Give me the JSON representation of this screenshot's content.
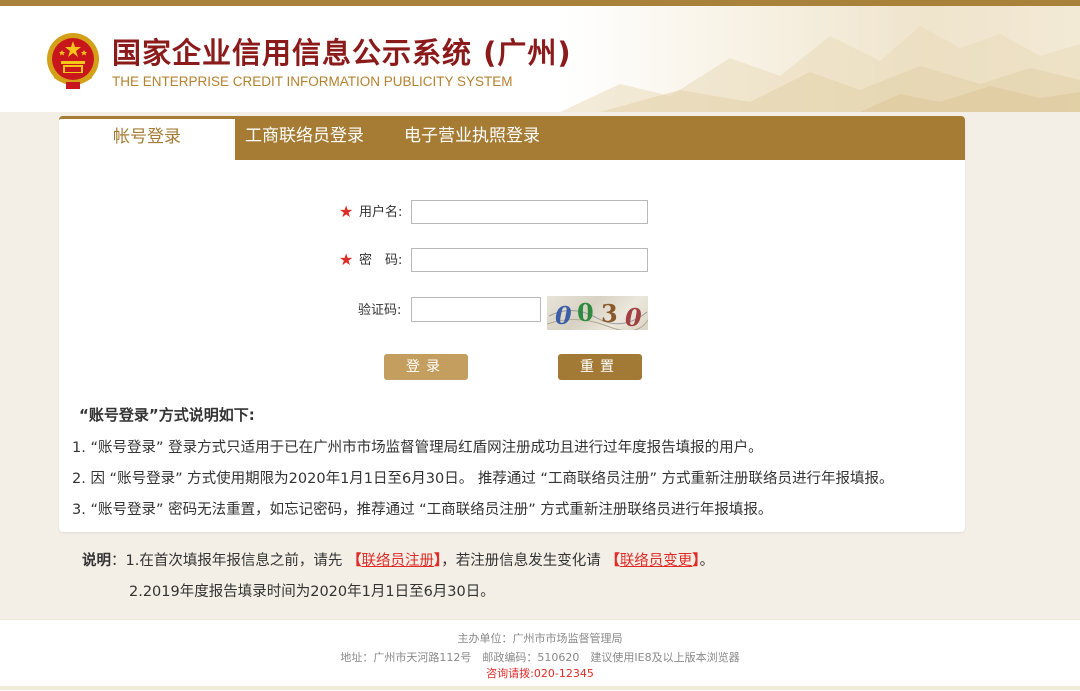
{
  "header": {
    "title": "国家企业信用信息公示系统 (广州)",
    "subtitle": "THE ENTERPRISE CREDIT INFORMATION PUBLICITY SYSTEM"
  },
  "tabs": [
    {
      "label": "帐号登录",
      "active": true
    },
    {
      "label": "工商联络员登录",
      "active": false
    },
    {
      "label": "电子营业执照登录",
      "active": false
    }
  ],
  "form": {
    "required_mark": "★",
    "username_label": "用户名:",
    "username_value": "",
    "password_label": "密　码:",
    "password_value": "",
    "captcha_label": "验证码:",
    "captcha_value": "",
    "captcha_chars": [
      "0",
      "0",
      "3",
      "0"
    ],
    "login_button": "登录",
    "reset_button": "重置"
  },
  "instructions": {
    "title": "“账号登录”方式说明如下:",
    "items": [
      "1. “账号登录” 登录方式只适用于已在广州市市场监督管理局红盾网注册成功且进行过年度报告填报的用户。",
      "2. 因 “账号登录” 方式使用期限为2020年1月1日至6月30日。 推荐通过 “工商联络员注册” 方式重新注册联络员进行年报填报。",
      "3. “账号登录” 密码无法重置，如忘记密码，推荐通过 “工商联络员注册” 方式重新注册联络员进行年报填报。"
    ]
  },
  "remarks": {
    "label": "说明",
    "line1_prefix": "：1.在首次填报年报信息之前，请先",
    "link1": "联络员注册",
    "line1_middle": "，若注册信息发生变化请",
    "link2": "联络员变更",
    "line1_suffix": "。",
    "line2": "2.2019年度报告填录时间为2020年1月1日至6月30日。"
  },
  "footer": {
    "sponsor": "主办单位：广州市市场监督管理局",
    "address": "地址：广州市天河路112号　邮政编码：510620　建议使用IE8及以上版本浏览器",
    "hotline": "咨询请拨:020-12345"
  },
  "colors": {
    "accent": "#a67c34",
    "title_red": "#8b1a1a",
    "link_red": "#e02b27"
  }
}
